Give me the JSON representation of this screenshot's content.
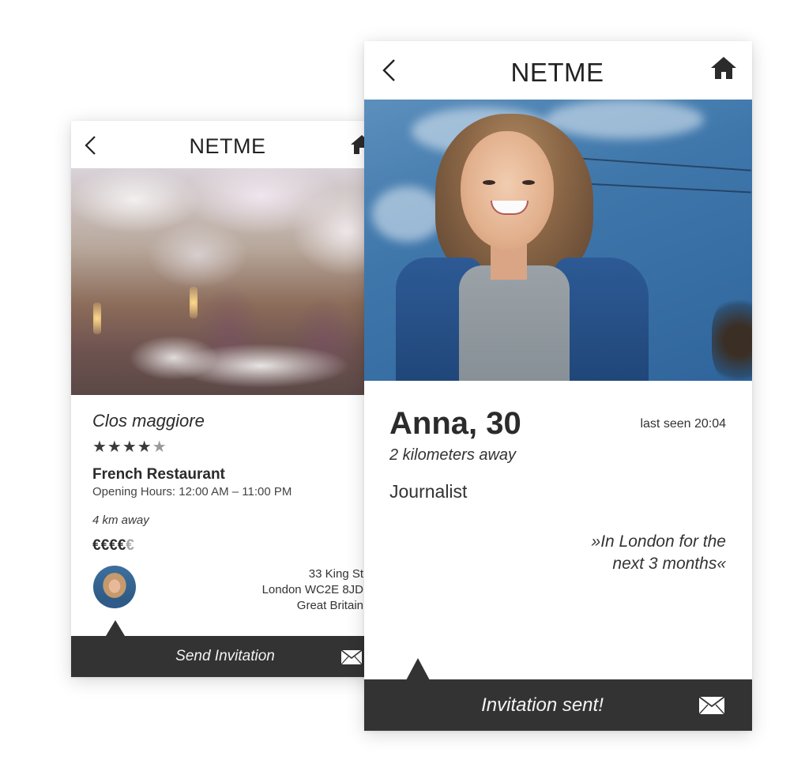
{
  "app": {
    "title": "NETME"
  },
  "restaurant": {
    "name": "Clos maggiore",
    "rating_stars": 4.5,
    "stars_full": "★★★★",
    "stars_half": "★",
    "type": "French Restaurant",
    "hours": "Opening Hours: 12:00 AM – 11:00 PM",
    "distance": "4 km away",
    "price_active": "€€€€",
    "price_inactive": "€",
    "address": [
      "33 King St",
      "London WC2E 8JD",
      "Great Britain"
    ],
    "action_label": "Send Invitation"
  },
  "profile": {
    "name": "Anna, 30",
    "last_seen": "last seen 20:04",
    "distance": "2 kilometers away",
    "occupation": "Journalist",
    "quote_line1": "»In London for the",
    "quote_line2": "next 3 months«",
    "action_label": "Invitation sent!"
  },
  "icons": {
    "back": "chevron-left-icon",
    "home": "home-icon",
    "mail": "envelope-icon"
  },
  "colors": {
    "bar": "#333333",
    "text": "#2b2b2b",
    "background": "#ffffff"
  }
}
